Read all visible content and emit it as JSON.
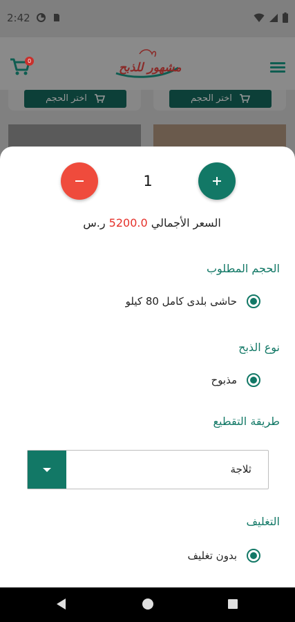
{
  "status_bar": {
    "time": "2:42"
  },
  "app_bar": {
    "cart_badge": "0",
    "logo_text": "مشهور للذبح"
  },
  "background_cards": {
    "pick_size_label": "اختر الحجم"
  },
  "sheet": {
    "quantity": "1",
    "price": {
      "label": "السعر الأجمالي",
      "amount": "5200.0",
      "currency": "ر.س"
    },
    "size_section": {
      "title": "الحجم المطلوب",
      "selected_option": "حاشى بلدى كامل 80 كيلو"
    },
    "slaughter_section": {
      "title": "نوع الذبح",
      "selected_option": "مذبوح"
    },
    "cutting_section": {
      "title": "طريقة التقطيع",
      "dropdown_value": "ثلاجة"
    },
    "packaging_section": {
      "title": "التغليف",
      "selected_option": "بدون تغليف"
    }
  },
  "colors": {
    "primary": "#127866",
    "minus": "#ef4b3c",
    "price_accent": "#e5312a"
  }
}
